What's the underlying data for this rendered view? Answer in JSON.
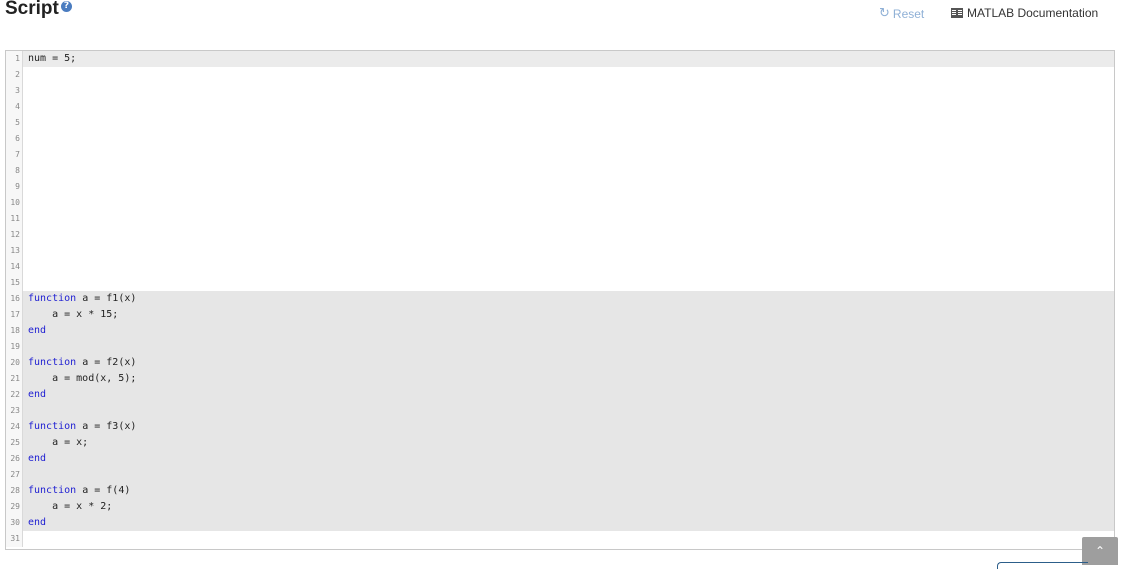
{
  "header": {
    "title": "Script",
    "help_icon": "question-circle-icon",
    "reset_label": "Reset",
    "reset_icon": "refresh-icon",
    "doc_label": "MATLAB Documentation",
    "doc_icon": "book-icon"
  },
  "colors": {
    "keyword": "#1f1fd2",
    "locked_background": "#e6e6e6",
    "reset_link": "#8fb0d6"
  },
  "editor": {
    "lines": [
      {
        "num": "1",
        "text": "num = 5;",
        "locked": false,
        "current": true
      },
      {
        "num": "2",
        "text": "",
        "locked": false
      },
      {
        "num": "3",
        "text": "",
        "locked": false
      },
      {
        "num": "4",
        "text": "",
        "locked": false
      },
      {
        "num": "5",
        "text": "",
        "locked": false
      },
      {
        "num": "6",
        "text": "",
        "locked": false
      },
      {
        "num": "7",
        "text": "",
        "locked": false
      },
      {
        "num": "8",
        "text": "",
        "locked": false
      },
      {
        "num": "9",
        "text": "",
        "locked": false
      },
      {
        "num": "10",
        "text": "",
        "locked": false
      },
      {
        "num": "11",
        "text": "",
        "locked": false
      },
      {
        "num": "12",
        "text": "",
        "locked": false
      },
      {
        "num": "13",
        "text": "",
        "locked": false
      },
      {
        "num": "14",
        "text": "",
        "locked": false
      },
      {
        "num": "15",
        "text": "",
        "locked": false
      },
      {
        "num": "16",
        "text": "function a = f1(x)",
        "locked": true
      },
      {
        "num": "17",
        "text": "    a = x * 15;",
        "locked": true
      },
      {
        "num": "18",
        "text": "end",
        "locked": true
      },
      {
        "num": "19",
        "text": "",
        "locked": true
      },
      {
        "num": "20",
        "text": "function a = f2(x)",
        "locked": true
      },
      {
        "num": "21",
        "text": "    a = mod(x, 5);",
        "locked": true
      },
      {
        "num": "22",
        "text": "end",
        "locked": true
      },
      {
        "num": "23",
        "text": "",
        "locked": true
      },
      {
        "num": "24",
        "text": "function a = f3(x)",
        "locked": true
      },
      {
        "num": "25",
        "text": "    a = x;",
        "locked": true
      },
      {
        "num": "26",
        "text": "end",
        "locked": true
      },
      {
        "num": "27",
        "text": "",
        "locked": true
      },
      {
        "num": "28",
        "text": "function a = f(4)",
        "locked": true
      },
      {
        "num": "29",
        "text": "    a = x * 2;",
        "locked": true
      },
      {
        "num": "30",
        "text": "end",
        "locked": true
      },
      {
        "num": "31",
        "text": "",
        "locked": false
      }
    ]
  },
  "scroll_top": {
    "icon": "chevron-up-icon",
    "glyph": "⌃"
  }
}
